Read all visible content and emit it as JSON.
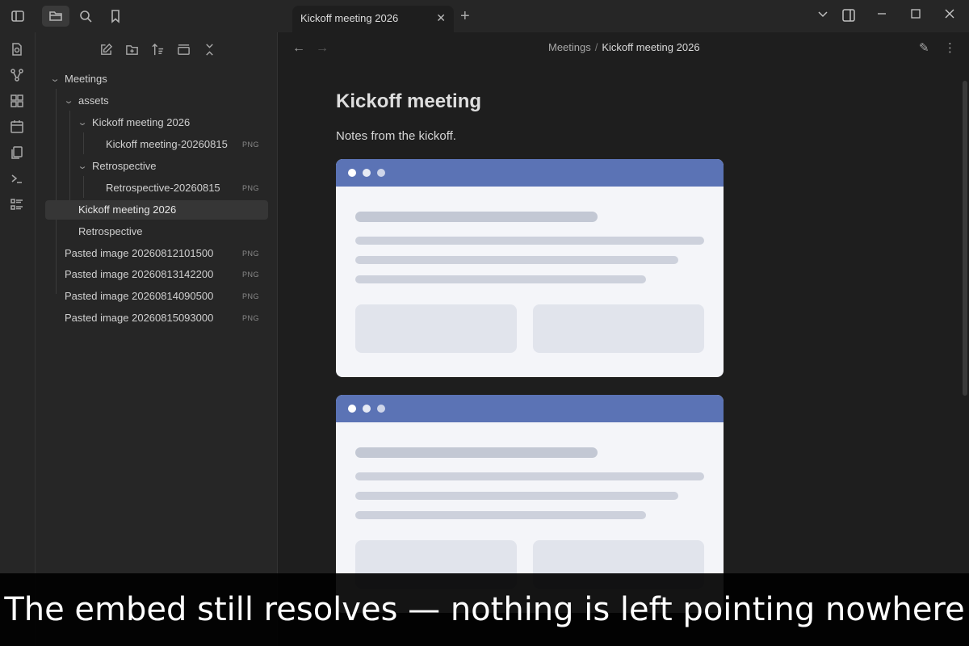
{
  "topbar": {
    "tab_title": "Kickoff meeting 2026",
    "tab_close": "✕",
    "new_tab": "+",
    "icons": [
      "sidebar-toggle-icon",
      "folder-icon",
      "search-icon",
      "bookmark-icon"
    ],
    "window_controls": [
      "⌄",
      "▢",
      "—",
      "☐",
      "✕"
    ]
  },
  "ribbon": {
    "icons": [
      "quick-switcher-icon",
      "graph-icon",
      "canvas-icon",
      "calendar-icon",
      "files-icon",
      "terminal-icon",
      "list-icon"
    ]
  },
  "sidebar": {
    "actions": [
      "new-note-icon",
      "new-folder-icon",
      "sort-icon",
      "collapse-view-icon",
      "collapse-all-icon"
    ],
    "tree": [
      {
        "label": "Meetings",
        "badge": ""
      },
      {
        "label": "assets",
        "badge": ""
      },
      {
        "label": "Kickoff meeting 2026",
        "badge": ""
      },
      {
        "label": "Kickoff meeting-20260815",
        "badge": "PNG"
      },
      {
        "label": "Retrospective",
        "badge": ""
      },
      {
        "label": "Retrospective-20260815",
        "badge": "PNG"
      },
      {
        "label": "Kickoff meeting 2026",
        "badge": ""
      },
      {
        "label": "Retrospective",
        "badge": ""
      },
      {
        "label": "Pasted image 20260812101500",
        "badge": "PNG"
      },
      {
        "label": "Pasted image 20260813142200",
        "badge": "PNG"
      },
      {
        "label": "Pasted image 20260814090500",
        "badge": "PNG"
      },
      {
        "label": "Pasted image 20260815093000",
        "badge": "PNG"
      }
    ]
  },
  "main": {
    "breadcrumb": {
      "folder": "Meetings",
      "sep": "/",
      "current": "Kickoff meeting 2026"
    },
    "nav": {
      "back": "←",
      "forward": "→"
    },
    "actions": {
      "edit": "✎",
      "more": "⋮"
    },
    "title": "Kickoff meeting",
    "text": "Notes from the kickoff."
  },
  "caption": "The embed still resolves — nothing is left pointing nowhere",
  "colors": {
    "accent": "#5b73b5",
    "background": "#1e1e1e",
    "sidebar": "#262626"
  }
}
